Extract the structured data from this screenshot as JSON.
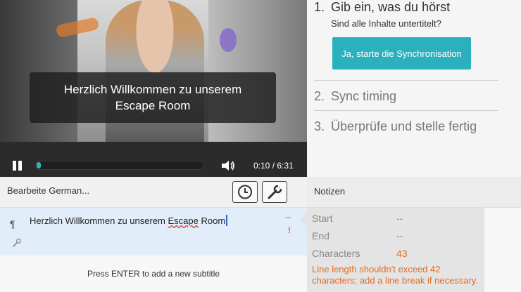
{
  "video": {
    "caption": "Herzlich Willkommen zu unserem Escape Room",
    "time": "0:10 / 6:31",
    "progress": 0.026
  },
  "steps": {
    "step1": {
      "number": "1.",
      "title": "Gib ein, was du hörst",
      "subtitle": "Sind alle Inhalte untertitelt?",
      "button": "Ja, starte die Synchronisation"
    },
    "step2": {
      "number": "2.",
      "title": "Sync timing"
    },
    "step3": {
      "number": "3.",
      "title": "Überprüfe und stelle fertig"
    }
  },
  "editor": {
    "toolbar_label": "Bearbeite German...",
    "notes_label": "Notizen",
    "subtitle_text_part1": "Herzlich Willkommen zu unserem ",
    "subtitle_text_err": "Escape",
    "subtitle_text_part2": " Room",
    "timing_dash": "--",
    "warning_mark": "!",
    "enter_hint": "Press ENTER to add a new subtitle"
  },
  "notes": {
    "start_label": "Start",
    "start_value": "--",
    "end_label": "End",
    "end_value": "--",
    "chars_label": "Characters",
    "chars_value": "43",
    "warning": "Line length shouldn't exceed 42 characters; add a line break if necessary."
  },
  "colors": {
    "accent": "#2bb0be",
    "warning": "#e46a1e",
    "progress": "#37b5b5"
  }
}
